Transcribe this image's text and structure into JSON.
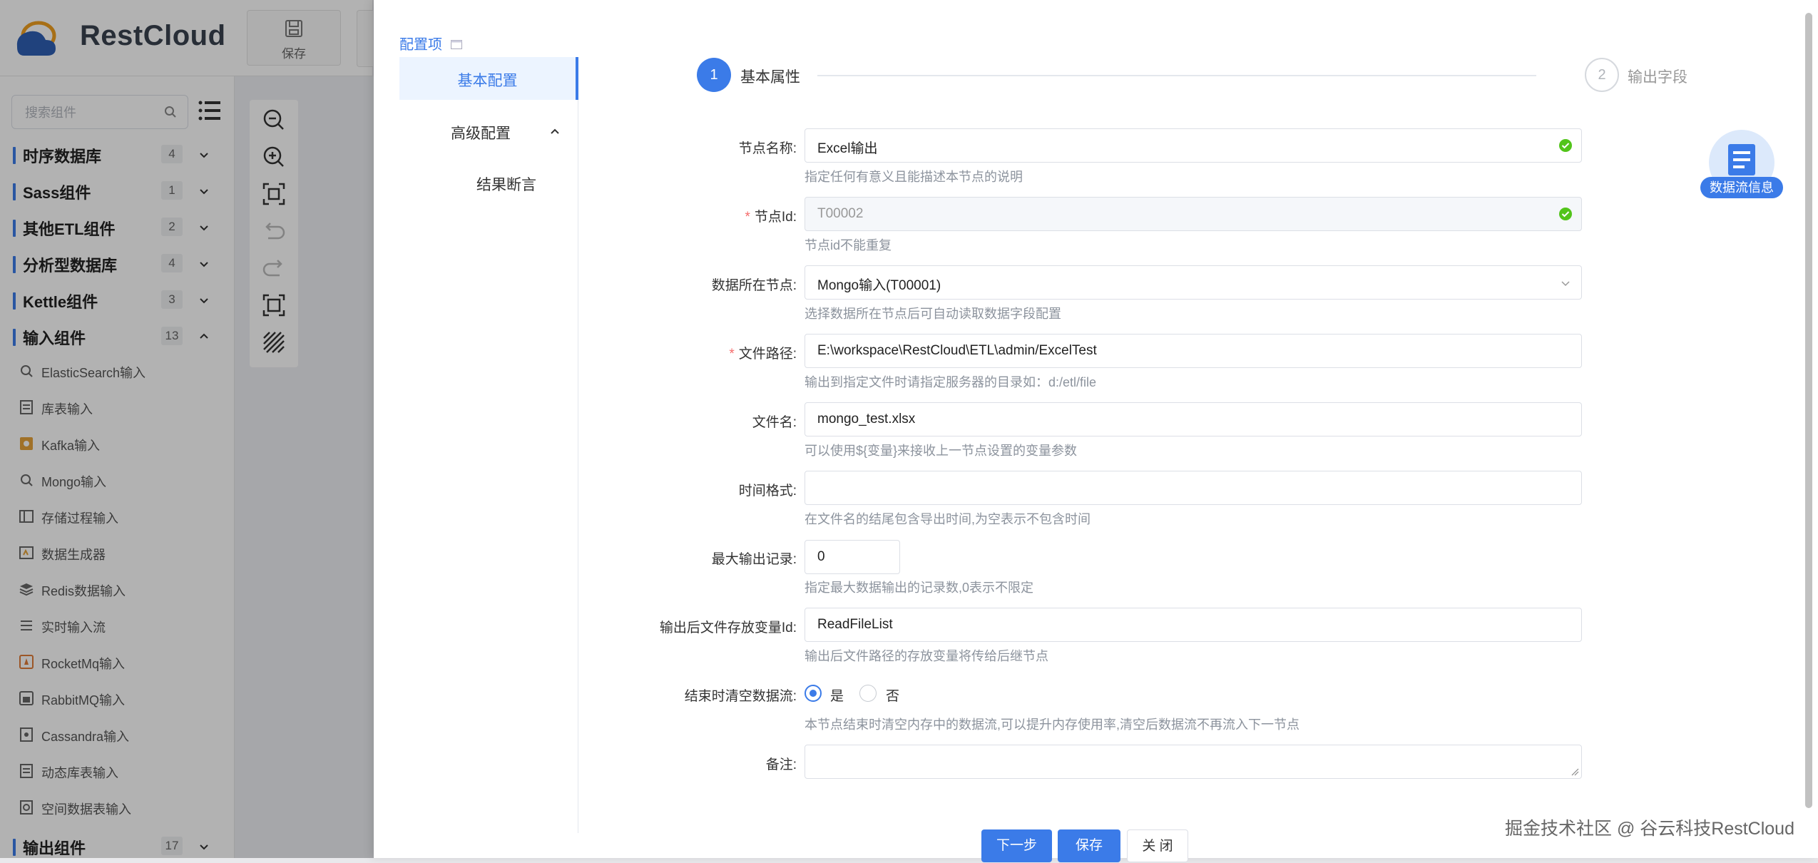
{
  "app": {
    "brand": "RestCloud",
    "toolbar_save": "保存"
  },
  "sidebar": {
    "search_placeholder": "搜索组件",
    "categories": [
      {
        "name": "时序数据库",
        "count": "4"
      },
      {
        "name": "Sass组件",
        "count": "1"
      },
      {
        "name": "其他ETL组件",
        "count": "2"
      },
      {
        "name": "分析型数据库",
        "count": "4"
      },
      {
        "name": "Kettle组件",
        "count": "3"
      },
      {
        "name": "输入组件",
        "count": "13"
      },
      {
        "name": "输出组件",
        "count": "17"
      }
    ],
    "items": [
      "ElasticSearch输入",
      "库表输入",
      "Kafka输入",
      "Mongo输入",
      "存储过程输入",
      "数据生成器",
      "Redis数据输入",
      "实时输入流",
      "RocketMq输入",
      "RabbitMQ输入",
      "Cassandra输入",
      "动态库表输入",
      "空间数据表输入"
    ]
  },
  "drawer": {
    "config_title": "配置项",
    "menu": {
      "basic": "基本配置",
      "advanced": "高级配置",
      "result": "结果断言"
    },
    "steps": [
      {
        "num": "1",
        "label": "基本属性"
      },
      {
        "num": "2",
        "label": "输出字段"
      }
    ],
    "form": {
      "node_name": {
        "label": "节点名称:",
        "value": "Excel输出",
        "hint": "指定任何有意义且能描述本节点的说明"
      },
      "node_id": {
        "label": "节点Id:",
        "value": "T00002",
        "hint": "节点id不能重复"
      },
      "data_node": {
        "label": "数据所在节点:",
        "value": "Mongo输入(T00001)",
        "hint": "选择数据所在节点后可自动读取数据字段配置"
      },
      "file_path": {
        "label": "文件路径:",
        "value": "E:\\workspace\\RestCloud\\ETL\\admin/ExcelTest",
        "hint": "输出到指定文件时请指定服务器的目录如：d:/etl/file"
      },
      "file_name": {
        "label": "文件名:",
        "value": "mongo_test.xlsx",
        "hint": "可以使用${变量}来接收上一节点设置的变量参数"
      },
      "time_format": {
        "label": "时间格式:",
        "value": "",
        "hint": "在文件名的结尾包含导出时间,为空表示不包含时间"
      },
      "max_records": {
        "label": "最大输出记录:",
        "value": "0",
        "hint": "指定最大数据输出的记录数,0表示不限定"
      },
      "var_id": {
        "label": "输出后文件存放变量Id:",
        "value": "ReadFileList",
        "hint": "输出后文件路径的存放变量将传给后继节点"
      },
      "clear_stream": {
        "label": "结束时清空数据流:",
        "yes": "是",
        "no": "否",
        "selected": "是",
        "hint": "本节点结束时清空内存中的数据流,可以提升内存使用率,清空后数据流不再流入下一节点"
      },
      "remark": {
        "label": "备注:",
        "value": ""
      }
    },
    "flow_info": "数据流信息",
    "buttons": {
      "next": "下一步",
      "save": "保存",
      "close": "关 闭"
    }
  },
  "watermark": "掘金技术社区 @ 谷云科技RestCloud",
  "colors": {
    "primary": "#3b7be8",
    "success": "#52c41a",
    "required": "#f56c6c"
  }
}
